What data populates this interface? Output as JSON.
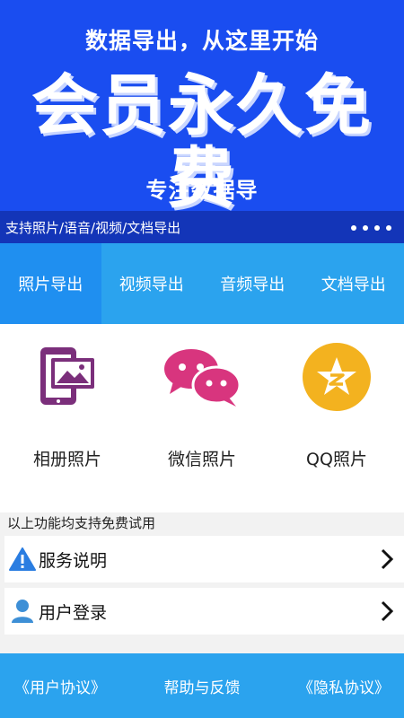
{
  "banner": {
    "tagline": "数据导出，从这里开始",
    "headline": "会员永久免费",
    "subline": "专注数据导"
  },
  "ticker": {
    "text": "支持照片/语音/视频/文档导出",
    "dots_count": 4
  },
  "tabs": [
    {
      "label": "照片导出",
      "active": true
    },
    {
      "label": "视频导出",
      "active": false
    },
    {
      "label": "音频导出",
      "active": false
    },
    {
      "label": "文档导出",
      "active": false
    }
  ],
  "grid": [
    {
      "label": "相册照片",
      "icon": "phone-gallery-icon"
    },
    {
      "label": "微信照片",
      "icon": "wechat-icon"
    },
    {
      "label": "QQ照片",
      "icon": "qzone-icon"
    }
  ],
  "note": "以上功能均支持免费试用",
  "rows": [
    {
      "label": "服务说明",
      "icon": "warning-icon"
    },
    {
      "label": "用户登录",
      "icon": "user-icon"
    }
  ],
  "footer": {
    "user_agreement": "《用户协议》",
    "help": "帮助与反馈",
    "privacy": "《隐私协议》"
  },
  "colors": {
    "banner_blue": "#1a4df0",
    "ticker_blue": "#1335b8",
    "tab_blue": "#2ba3ee",
    "tab_active": "#1f8ff0",
    "gallery_purple": "#7b2f7b",
    "wechat_pink": "#d8357e",
    "qzone_yellow": "#f3b21f",
    "warning_blue": "#2a7de1",
    "user_blue": "#3d8fd6"
  }
}
